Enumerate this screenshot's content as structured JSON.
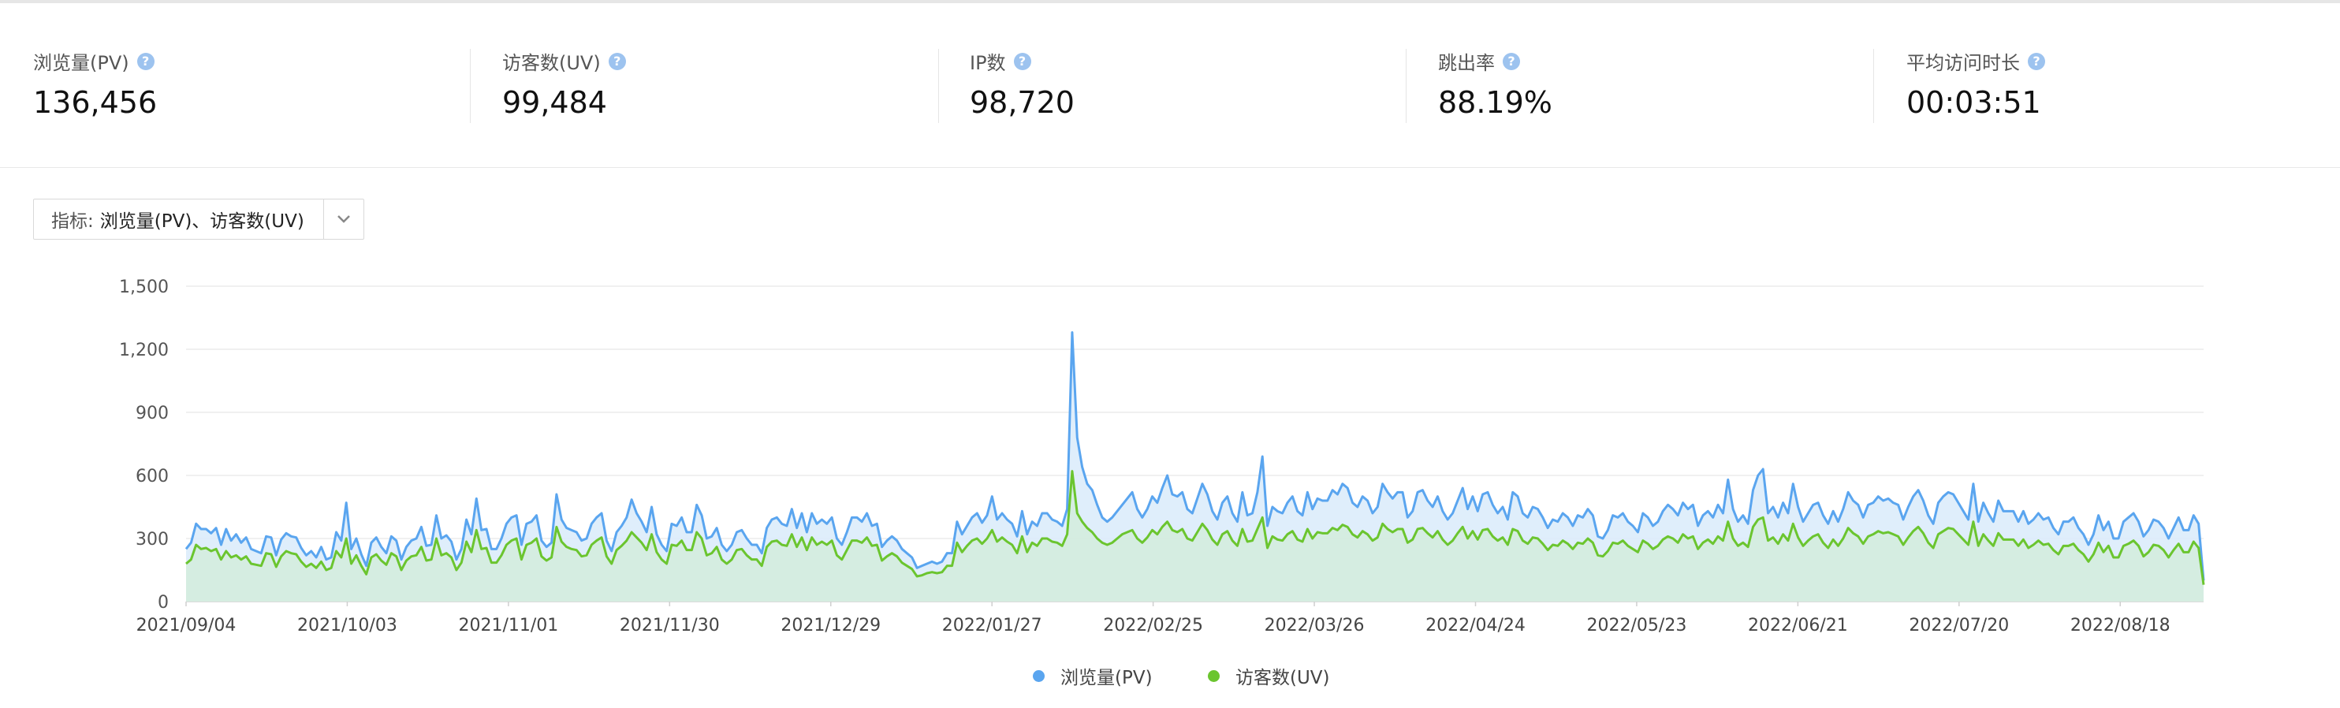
{
  "stats": [
    {
      "label": "浏览量(PV)",
      "value": "136,456"
    },
    {
      "label": "访客数(UV)",
      "value": "99,484"
    },
    {
      "label": "IP数",
      "value": "98,720"
    },
    {
      "label": "跳出率",
      "value": "88.19%"
    },
    {
      "label": "平均访问时长",
      "value": "00:03:51"
    }
  ],
  "help_glyph": "?",
  "selector": {
    "label": "指标:",
    "value": "浏览量(PV)、访客数(UV)"
  },
  "colors": {
    "pv": "#5aa5ef",
    "uv": "#6bc52f",
    "pv_fill": "#dcecfb",
    "uv_fill": "#d3ecdc",
    "help": "#9dc3ef"
  },
  "chart_data": {
    "type": "area",
    "title": "",
    "xlabel": "",
    "ylabel": "",
    "ylim": [
      0,
      1500
    ],
    "yticks": [
      "0",
      "300",
      "600",
      "900",
      "1,200",
      "1,500"
    ],
    "xtick_labels": [
      "2021/09/04",
      "2021/10/03",
      "2021/11/01",
      "2021/11/30",
      "2021/12/29",
      "2022/01/27",
      "2022/02/25",
      "2022/03/26",
      "2022/04/24",
      "2022/05/23",
      "2022/06/21",
      "2022/07/20",
      "2022/08/18"
    ],
    "x_start": "2021/09/04",
    "x_end": "2022/09/02",
    "grid": true,
    "legend_position": "bottom",
    "series": [
      {
        "name": "浏览量(PV)",
        "color": "#5aa5ef",
        "values": [
          250,
          280,
          370,
          345,
          345,
          325,
          350,
          270,
          345,
          290,
          320,
          280,
          305,
          250,
          240,
          230,
          310,
          305,
          220,
          295,
          325,
          310,
          305,
          255,
          220,
          240,
          210,
          260,
          200,
          210,
          330,
          290,
          470,
          250,
          300,
          225,
          170,
          280,
          305,
          260,
          230,
          310,
          290,
          200,
          260,
          290,
          300,
          355,
          265,
          270,
          410,
          300,
          315,
          285,
          200,
          250,
          390,
          320,
          490,
          340,
          345,
          250,
          250,
          300,
          370,
          400,
          410,
          270,
          370,
          380,
          410,
          290,
          260,
          280,
          510,
          390,
          350,
          340,
          330,
          290,
          300,
          370,
          400,
          420,
          290,
          240,
          330,
          360,
          400,
          485,
          420,
          380,
          330,
          450,
          320,
          270,
          240,
          370,
          360,
          400,
          330,
          330,
          460,
          410,
          300,
          310,
          350,
          270,
          240,
          270,
          330,
          340,
          300,
          270,
          270,
          230,
          350,
          390,
          400,
          370,
          360,
          440,
          350,
          420,
          330,
          420,
          370,
          390,
          370,
          400,
          300,
          270,
          330,
          400,
          400,
          380,
          420,
          360,
          370,
          260,
          290,
          310,
          290,
          250,
          230,
          210,
          160,
          170,
          180,
          190,
          180,
          190,
          230,
          230,
          380,
          320,
          360,
          400,
          420,
          375,
          410,
          500,
          390,
          420,
          390,
          370,
          310,
          430,
          320,
          380,
          360,
          420,
          420,
          390,
          380,
          360,
          440,
          1280,
          780,
          640,
          560,
          530,
          460,
          400,
          380,
          400,
          430,
          460,
          490,
          520,
          440,
          400,
          440,
          500,
          470,
          540,
          600,
          510,
          500,
          520,
          440,
          420,
          490,
          560,
          510,
          430,
          390,
          470,
          500,
          420,
          380,
          520,
          410,
          420,
          520,
          690,
          360,
          450,
          430,
          420,
          470,
          500,
          430,
          410,
          520,
          440,
          490,
          480,
          480,
          530,
          510,
          560,
          540,
          470,
          450,
          500,
          480,
          420,
          450,
          560,
          520,
          490,
          520,
          520,
          400,
          430,
          520,
          530,
          480,
          450,
          500,
          430,
          390,
          420,
          480,
          540,
          440,
          500,
          430,
          510,
          520,
          460,
          420,
          450,
          390,
          520,
          500,
          420,
          400,
          450,
          440,
          400,
          350,
          390,
          380,
          420,
          400,
          360,
          410,
          400,
          440,
          410,
          310,
          300,
          340,
          410,
          400,
          420,
          380,
          360,
          330,
          420,
          400,
          360,
          380,
          430,
          460,
          440,
          410,
          470,
          440,
          460,
          360,
          410,
          430,
          400,
          460,
          420,
          580,
          440,
          380,
          410,
          370,
          530,
          600,
          630,
          420,
          450,
          400,
          470,
          420,
          560,
          450,
          380,
          420,
          460,
          470,
          410,
          370,
          430,
          380,
          440,
          520,
          480,
          460,
          400,
          460,
          470,
          500,
          480,
          490,
          470,
          460,
          390,
          450,
          500,
          530,
          480,
          410,
          370,
          470,
          500,
          520,
          510,
          470,
          430,
          390,
          560,
          380,
          470,
          420,
          380,
          480,
          430,
          430,
          430,
          380,
          430,
          370,
          390,
          420,
          390,
          400,
          350,
          320,
          380,
          380,
          400,
          350,
          320,
          270,
          320,
          410,
          340,
          380,
          300,
          300,
          380,
          400,
          420,
          380,
          310,
          340,
          390,
          380,
          350,
          300,
          350,
          400,
          340,
          340,
          410,
          370,
          100
        ]
      },
      {
        "name": "访客数(UV)",
        "color": "#6bc52f",
        "values": [
          180,
          200,
          270,
          250,
          255,
          240,
          250,
          200,
          240,
          210,
          220,
          200,
          215,
          180,
          175,
          170,
          230,
          225,
          165,
          215,
          240,
          230,
          225,
          190,
          165,
          180,
          160,
          190,
          150,
          160,
          240,
          210,
          300,
          180,
          220,
          170,
          130,
          210,
          225,
          195,
          175,
          230,
          215,
          150,
          195,
          215,
          220,
          260,
          195,
          200,
          300,
          220,
          230,
          210,
          150,
          185,
          285,
          235,
          340,
          250,
          255,
          185,
          185,
          220,
          270,
          290,
          300,
          200,
          270,
          280,
          300,
          215,
          195,
          210,
          355,
          285,
          260,
          250,
          245,
          215,
          220,
          270,
          290,
          305,
          215,
          180,
          245,
          265,
          290,
          330,
          305,
          280,
          245,
          320,
          235,
          200,
          180,
          270,
          265,
          290,
          245,
          245,
          330,
          300,
          220,
          230,
          260,
          200,
          180,
          200,
          245,
          250,
          220,
          200,
          200,
          170,
          260,
          285,
          290,
          270,
          265,
          320,
          260,
          305,
          245,
          305,
          270,
          285,
          270,
          290,
          220,
          200,
          245,
          290,
          290,
          280,
          305,
          265,
          270,
          195,
          215,
          230,
          215,
          185,
          170,
          155,
          120,
          125,
          135,
          140,
          135,
          140,
          170,
          170,
          280,
          235,
          265,
          290,
          300,
          275,
          300,
          340,
          285,
          305,
          285,
          270,
          230,
          310,
          235,
          280,
          265,
          300,
          300,
          285,
          280,
          265,
          320,
          620,
          420,
          380,
          350,
          330,
          300,
          280,
          270,
          280,
          300,
          320,
          330,
          340,
          300,
          280,
          305,
          340,
          320,
          355,
          380,
          340,
          330,
          345,
          300,
          290,
          330,
          370,
          340,
          295,
          270,
          320,
          335,
          290,
          265,
          345,
          285,
          290,
          345,
          400,
          255,
          310,
          295,
          290,
          320,
          335,
          295,
          285,
          345,
          300,
          330,
          325,
          325,
          350,
          340,
          365,
          355,
          320,
          305,
          335,
          320,
          290,
          305,
          370,
          345,
          330,
          345,
          345,
          280,
          295,
          345,
          350,
          325,
          305,
          335,
          295,
          270,
          290,
          325,
          355,
          300,
          335,
          295,
          340,
          345,
          310,
          290,
          305,
          270,
          345,
          335,
          290,
          275,
          305,
          300,
          275,
          245,
          270,
          265,
          290,
          275,
          250,
          280,
          275,
          300,
          280,
          220,
          215,
          240,
          280,
          275,
          290,
          265,
          250,
          235,
          290,
          275,
          250,
          265,
          295,
          310,
          300,
          280,
          320,
          300,
          310,
          250,
          280,
          295,
          275,
          310,
          290,
          380,
          300,
          265,
          280,
          260,
          355,
          390,
          400,
          290,
          305,
          275,
          320,
          290,
          370,
          305,
          265,
          290,
          310,
          320,
          280,
          255,
          295,
          265,
          300,
          350,
          325,
          310,
          275,
          310,
          320,
          335,
          325,
          330,
          320,
          310,
          270,
          305,
          335,
          355,
          325,
          280,
          255,
          320,
          335,
          350,
          345,
          320,
          295,
          270,
          380,
          265,
          320,
          290,
          265,
          325,
          295,
          295,
          295,
          265,
          295,
          255,
          270,
          290,
          270,
          275,
          245,
          225,
          265,
          265,
          275,
          245,
          225,
          190,
          225,
          280,
          235,
          265,
          210,
          210,
          265,
          275,
          290,
          265,
          215,
          235,
          270,
          265,
          245,
          210,
          245,
          275,
          235,
          235,
          285,
          255,
          80
        ]
      }
    ]
  }
}
